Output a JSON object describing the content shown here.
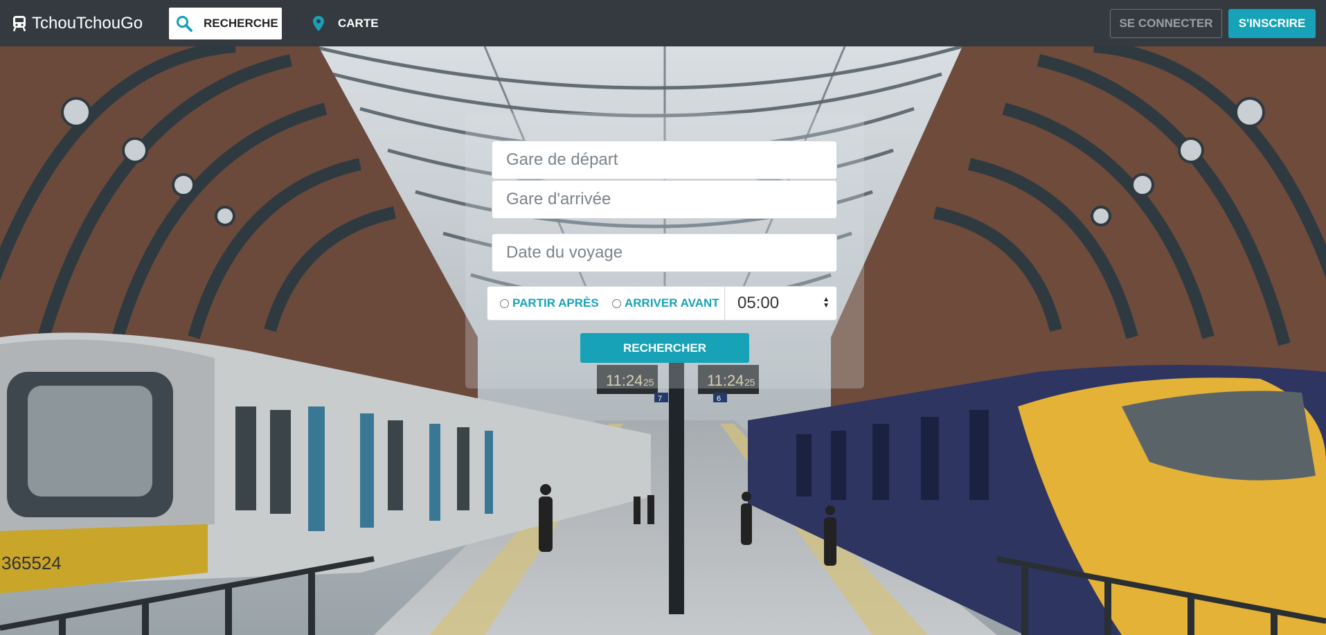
{
  "nav": {
    "brand": "TchouTchouGo",
    "search_label": "RECHERCHE",
    "map_label": "CARTE",
    "login_label": "SE CONNECTER",
    "signup_label": "S'INSCRIRE"
  },
  "form": {
    "departure_placeholder": "Gare de départ",
    "arrival_placeholder": "Gare d'arrivée",
    "date_placeholder": "Date du voyage",
    "option_after": "PARTIR APRÈS",
    "option_before": "ARRIVER AVANT",
    "time_value": "05:00",
    "submit_label": "RECHERCHER"
  },
  "background": {
    "clock_left": "11:24",
    "clock_left_sec": "25",
    "clock_right": "11:24",
    "clock_right_sec": "25",
    "platform_left": "7",
    "platform_right": "6",
    "train_number": "365524"
  },
  "colors": {
    "navbar": "#343a40",
    "accent": "#17a2b8"
  },
  "icons": [
    "train-icon",
    "search-icon",
    "map-pin-icon"
  ]
}
